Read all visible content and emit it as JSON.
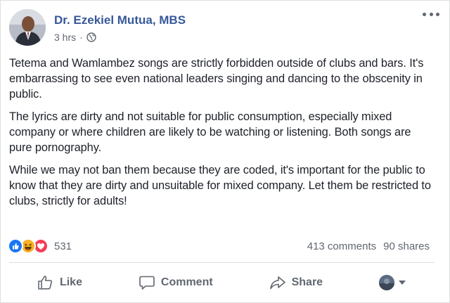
{
  "post": {
    "author": "Dr. Ezekiel Mutua, MBS",
    "time": "3 hrs",
    "separator": "·",
    "audience_icon": "globe-icon",
    "paragraphs": [
      "Tetema and Wamlambez songs are strictly forbidden outside of clubs and bars. It's embarrassing to see even national leaders singing and dancing to the obscenity in public.",
      "The lyrics are dirty and not suitable for public consumption, especially mixed company or where children are likely to be watching or listening. Both songs are pure pornography.",
      "While we may not ban them because they are coded, it's important for the public to know that they are dirty and unsuitable for mixed company. Let them be restricted to clubs, strictly for adults!"
    ]
  },
  "stats": {
    "reactions": [
      "like-reaction-icon",
      "haha-reaction-icon",
      "love-reaction-icon"
    ],
    "reaction_count": "531",
    "comments": "413 comments",
    "shares": "90 shares"
  },
  "actions": {
    "like": "Like",
    "comment": "Comment",
    "share": "Share"
  },
  "colors": {
    "link_blue": "#365899",
    "like_blue": "#1877f2",
    "haha_yellow": "#f7b125",
    "love_red": "#f33e58",
    "muted": "#606770"
  }
}
